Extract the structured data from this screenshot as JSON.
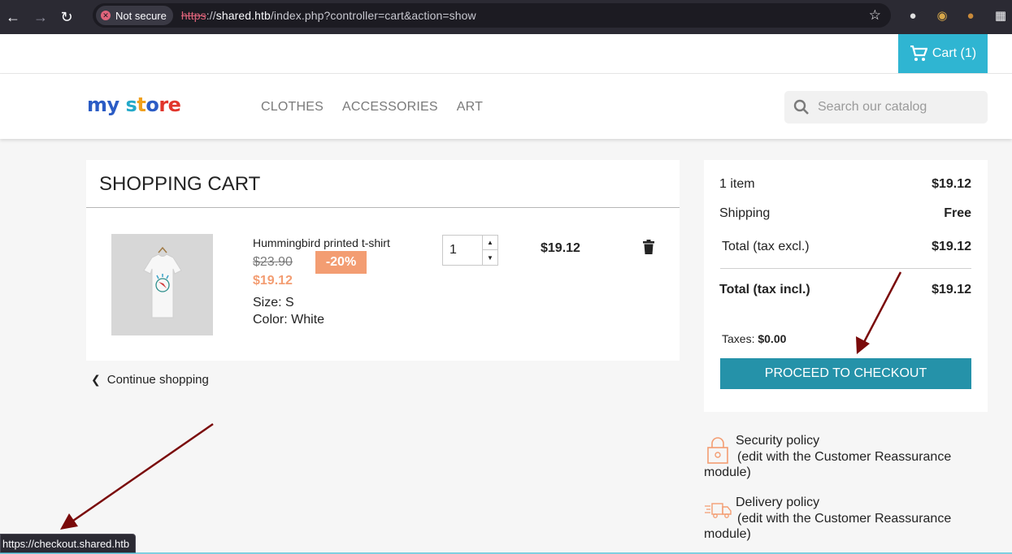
{
  "browser": {
    "security_label": "Not secure",
    "url_scheme": "https",
    "url_sep": "://",
    "url_host": "shared.htb",
    "url_path": "/index.php?controller=cart&action=show",
    "status_url": "https://checkout.shared.htb"
  },
  "header": {
    "cart_label": "Cart (1)",
    "logo_text": "my store",
    "menu": [
      "CLOTHES",
      "ACCESSORIES",
      "ART"
    ],
    "search_placeholder": "Search our catalog"
  },
  "cart": {
    "title": "SHOPPING CART",
    "item": {
      "name": "Hummingbird printed t-shirt",
      "old_price": "$23.90",
      "discount": "-20%",
      "price": "$19.12",
      "size_label": "Size:",
      "size_value": "S",
      "color_label": "Color:",
      "color_value": "White",
      "quantity": "1",
      "line_total": "$19.12"
    },
    "continue_label": "Continue shopping"
  },
  "summary": {
    "items_label": "1 item",
    "items_value": "$19.12",
    "shipping_label": "Shipping",
    "shipping_value": "Free",
    "total_excl_label": "Total (tax excl.)",
    "total_excl_value": "$19.12",
    "total_incl_label": "Total (tax incl.)",
    "total_incl_value": "$19.12",
    "taxes_label": "Taxes:",
    "taxes_value": "$0.00",
    "checkout_label": "PROCEED TO CHECKOUT"
  },
  "reassurance": [
    {
      "title": "Security policy",
      "note": "(edit with the Customer Reassurance module)"
    },
    {
      "title": "Delivery policy",
      "note": "(edit with the Customer Reassurance module)"
    }
  ],
  "colors": {
    "accent": "#2fb5d2",
    "checkout": "#2592a9",
    "discount": "#f39d72",
    "annotation_arrow": "#7a0a0a"
  }
}
